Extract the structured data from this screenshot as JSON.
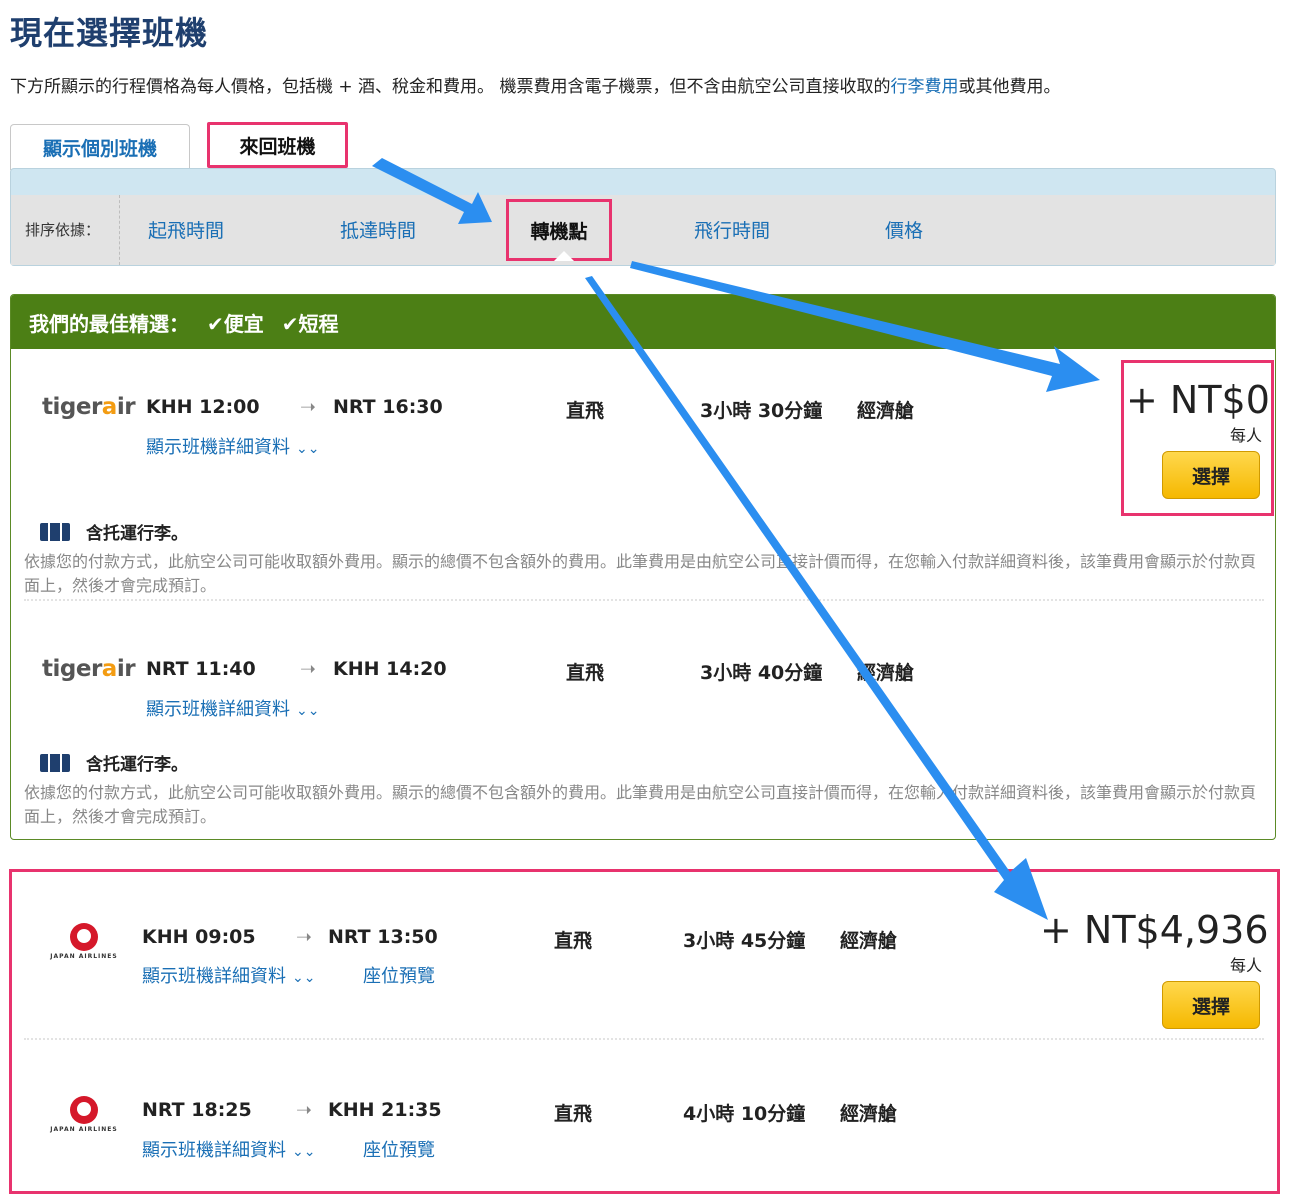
{
  "page": {
    "title": "現在選擇班機",
    "intro_prefix": "下方所顯示的行程價格為每人價格，包括機 + 酒、稅金和費用。 機票費用含電子機票，但不含由航空公司直接收取的",
    "intro_link": "行李費用",
    "intro_suffix": "或其他費用。"
  },
  "tabs": [
    {
      "label": "顯示個別班機"
    },
    {
      "label": "來回班機"
    }
  ],
  "sort": {
    "label": "排序依據：",
    "options": [
      "起飛時間",
      "抵達時間",
      "轉機點",
      "飛行時間",
      "價格"
    ]
  },
  "best_picks": {
    "title": "我們的最佳精選：",
    "tags": [
      "便宜",
      "短程"
    ],
    "flights": [
      {
        "airline": "tigerair",
        "depart": "KHH 12:00",
        "arrive": "NRT 16:30",
        "stops": "直飛",
        "duration": "3小時 30分鐘",
        "cabin": "經濟艙",
        "details": "顯示班機詳細資料",
        "baggage": "含托運行李。",
        "note": "依據您的付款方式，此航空公司可能收取額外費用。顯示的總價不包含額外的費用。此筆費用是由航空公司直接計價而得，在您輸入付款詳細資料後，該筆費用會顯示於付款頁面上，然後才會完成預訂。"
      },
      {
        "airline": "tigerair",
        "depart": "NRT 11:40",
        "arrive": "KHH 14:20",
        "stops": "直飛",
        "duration": "3小時 40分鐘",
        "cabin": "經濟艙",
        "details": "顯示班機詳細資料",
        "baggage": "含托運行李。",
        "note": "依據您的付款方式，此航空公司可能收取額外費用。顯示的總價不包含額外的費用。此筆費用是由航空公司直接計價而得，在您輸入付款詳細資料後，該筆費用會顯示於付款頁面上，然後才會完成預訂。"
      }
    ],
    "price": "+ NT$0",
    "per_person": "每人",
    "select_label": "選擇"
  },
  "option2": {
    "flights": [
      {
        "airline": "JAPAN AIRLINES",
        "depart": "KHH 09:05",
        "arrive": "NRT 13:50",
        "stops": "直飛",
        "duration": "3小時 45分鐘",
        "cabin": "經濟艙",
        "details": "顯示班機詳細資料",
        "seat": "座位預覽"
      },
      {
        "airline": "JAPAN AIRLINES",
        "depart": "NRT 18:25",
        "arrive": "KHH 21:35",
        "stops": "直飛",
        "duration": "4小時 10分鐘",
        "cabin": "經濟艙",
        "details": "顯示班機詳細資料",
        "seat": "座位預覽"
      }
    ],
    "price": "+ NT$4,936",
    "per_person": "每人",
    "select_label": "選擇"
  },
  "colors": {
    "highlight": "#e8336e",
    "annotation_arrow": "#2b8ef0",
    "best_header": "#4c7f15",
    "link": "#1a6fb5",
    "select_button": "#f5b800"
  }
}
